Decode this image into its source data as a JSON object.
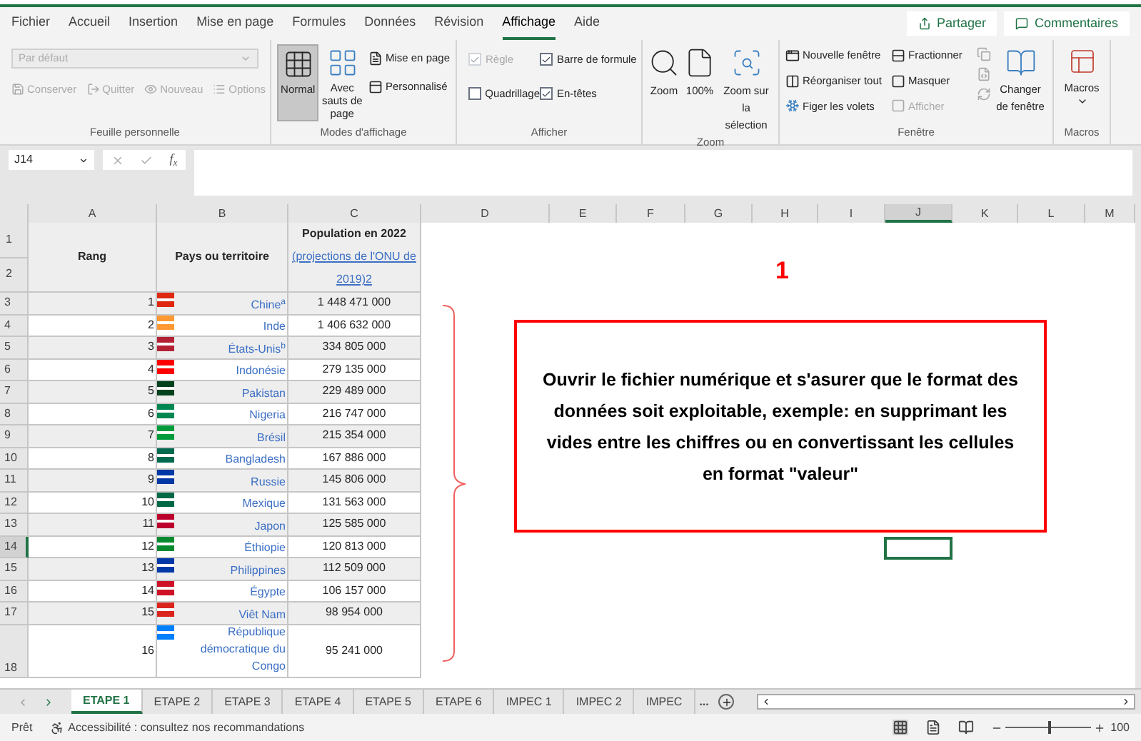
{
  "menu": [
    {
      "label": "Fichier",
      "selected": false
    },
    {
      "label": "Accueil",
      "selected": false
    },
    {
      "label": "Insertion",
      "selected": false
    },
    {
      "label": "Mise en page",
      "selected": false
    },
    {
      "label": "Formules",
      "selected": false
    },
    {
      "label": "Données",
      "selected": false
    },
    {
      "label": "Révision",
      "selected": false
    },
    {
      "label": "Affichage",
      "selected": true
    },
    {
      "label": "Aide",
      "selected": false
    }
  ],
  "share_button": "Partager",
  "comments_button": "Commentaires",
  "sheet_view": {
    "dropdown": "Par défaut",
    "buttons": [
      "Conserver",
      "Quitter",
      "Nouveau",
      "Options"
    ],
    "label": "Feuille personnelle"
  },
  "views": {
    "buttons": [
      {
        "label": "Normal",
        "selected": true
      },
      {
        "label": "Avec sauts de page",
        "selected": false
      }
    ],
    "small": [
      "Mise en page",
      "Personnalisé"
    ],
    "label": "Modes d'affichage"
  },
  "show": {
    "checks": [
      {
        "label": "Règle",
        "checked": true,
        "disabled": true
      },
      {
        "label": "Barre de formule",
        "checked": true,
        "disabled": false
      },
      {
        "label": "Quadrillage",
        "checked": false,
        "disabled": false
      },
      {
        "label": "En-têtes",
        "checked": true,
        "disabled": false
      }
    ],
    "label": "Afficher"
  },
  "zoom": {
    "buttons": [
      "Zoom",
      "100%",
      "Zoom sur la sélection"
    ],
    "label": "Zoom"
  },
  "window": {
    "items": [
      {
        "label": "Nouvelle fenêtre",
        "disabled": false
      },
      {
        "label": "Fractionner",
        "disabled": false
      },
      {
        "label": "Réorganiser tout",
        "disabled": false
      },
      {
        "label": "Masquer",
        "disabled": false
      },
      {
        "label": "Figer les volets",
        "disabled": false
      },
      {
        "label": "Afficher",
        "disabled": true
      }
    ],
    "switch": "Changer de fenêtre",
    "label": "Fenêtre"
  },
  "macros": {
    "button": "Macros",
    "label": "Macros"
  },
  "formula_bar": {
    "name_box": "J14",
    "function_label": "f$_{x}$"
  },
  "columns": [
    {
      "label": "A",
      "selected": false
    },
    {
      "label": "B",
      "selected": false
    },
    {
      "label": "C",
      "selected": false
    },
    {
      "label": "D",
      "selected": false
    },
    {
      "label": "E",
      "selected": false
    },
    {
      "label": "F",
      "selected": false
    },
    {
      "label": "G",
      "selected": false
    },
    {
      "label": "H",
      "selected": false
    },
    {
      "label": "I",
      "selected": false
    },
    {
      "label": "J",
      "selected": true
    },
    {
      "label": "K",
      "selected": false
    },
    {
      "label": "L",
      "selected": false
    },
    {
      "label": "M",
      "selected": false
    }
  ],
  "header": {
    "row_numbers": [
      "1",
      "2"
    ],
    "rank": "Rang",
    "country": "Pays ou territoire",
    "population_title": "Population en 2022",
    "population_link": "(projections de l'ONU de 2019)2"
  },
  "rows": [
    {
      "row": "3",
      "selected": false,
      "rank": "1",
      "country": "Chine$^{a}$",
      "population": "1 448 471 000",
      "color": "#de2910"
    },
    {
      "row": "4",
      "selected": false,
      "rank": "2",
      "country": "Inde",
      "population": "1 406 632 000",
      "color": "#ff9933"
    },
    {
      "row": "5",
      "selected": false,
      "rank": "3",
      "country": "États-Unis$^{b}$",
      "population": "334 805 000",
      "color": "#b22234"
    },
    {
      "row": "6",
      "selected": false,
      "rank": "4",
      "country": "Indonésie",
      "population": "279 135 000",
      "color": "#ff0000"
    },
    {
      "row": "7",
      "selected": false,
      "rank": "5",
      "country": "Pakistan",
      "population": "229 489 000",
      "color": "#01411c"
    },
    {
      "row": "8",
      "selected": false,
      "rank": "6",
      "country": "Nigeria",
      "population": "216 747 000",
      "color": "#008751"
    },
    {
      "row": "9",
      "selected": false,
      "rank": "7",
      "country": "Brésil",
      "population": "215 354 000",
      "color": "#009c3b"
    },
    {
      "row": "10",
      "selected": false,
      "rank": "8",
      "country": "Bangladesh",
      "population": "167 886 000",
      "color": "#006a4e"
    },
    {
      "row": "11",
      "selected": false,
      "rank": "9",
      "country": "Russie",
      "population": "145 806 000",
      "color": "#0039a6"
    },
    {
      "row": "12",
      "selected": false,
      "rank": "10",
      "country": "Mexique",
      "population": "131 563 000",
      "color": "#006847"
    },
    {
      "row": "13",
      "selected": false,
      "rank": "11",
      "country": "Japon",
      "population": "125 585 000",
      "color": "#bc002d"
    },
    {
      "row": "14",
      "selected": true,
      "rank": "12",
      "country": "Éthiopie",
      "population": "120 813 000",
      "color": "#078930"
    },
    {
      "row": "15",
      "selected": false,
      "rank": "13",
      "country": "Philippines",
      "population": "112 509 000",
      "color": "#0038a8"
    },
    {
      "row": "16",
      "selected": false,
      "rank": "14",
      "country": "Égypte",
      "population": "106 157 000",
      "color": "#ce1126"
    },
    {
      "row": "17",
      "selected": false,
      "rank": "15",
      "country": "Viêt Nam",
      "population": "98 954 000",
      "color": "#da251d"
    },
    {
      "row": "18",
      "selected": false,
      "rank": "16",
      "country": "République démocratique du Congo",
      "population": "95 241 000",
      "color": "#007fff"
    }
  ],
  "annotation": {
    "step_number": "1",
    "instruction": "Ouvrir le fichier numérique et s'asurer que le format des données soit exploitable, exemple: en supprimant les vides entre les chiffres ou en convertissant les cellules en format \"valeur\""
  },
  "sheet_tabs": [
    {
      "label": "ETAPE 1",
      "selected": true
    },
    {
      "label": "ETAPE 2",
      "selected": false
    },
    {
      "label": "ETAPE 3",
      "selected": false
    },
    {
      "label": "ETAPE 4",
      "selected": false
    },
    {
      "label": "ETAPE 5",
      "selected": false
    },
    {
      "label": "ETAPE 6",
      "selected": false
    },
    {
      "label": "IMPEC 1",
      "selected": false
    },
    {
      "label": "IMPEC 2",
      "selected": false
    },
    {
      "label": "IMPEC",
      "selected": false
    }
  ],
  "more_tabs": "...",
  "status_bar": {
    "status": "Prêt",
    "accessibility": "Accessibilité : consultez nos recommandations",
    "zoom": {
      "level": 0.5,
      "reading": "100"
    }
  }
}
